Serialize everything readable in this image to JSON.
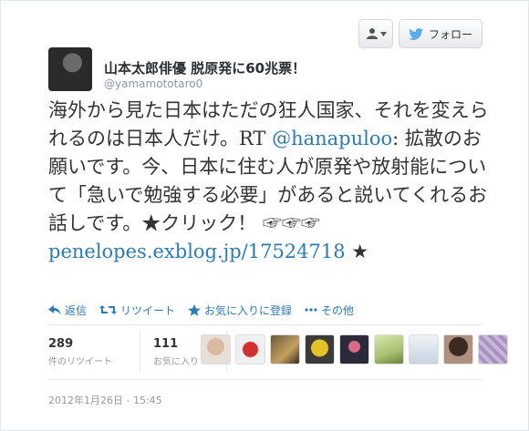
{
  "header": {
    "follow_label": "フォロー"
  },
  "author": {
    "name": "山本太郎俳優 脱原発に60兆票！",
    "handle": "@yamamototaro0"
  },
  "tweet": {
    "part1": "海外から見た日本はただの狂人国家、それを変えられるのは日本人だけ。RT ",
    "mention": "@hanapuloo",
    "part2": ": 拡散のお願いです。今、日本に住む人が原発や放射能について「急いで勉強する必要」があると説いてくれるお話しです。★クリック！ ☞☞☞ ",
    "link": "penelopes.exblog.jp/17524718",
    "part3": " ★"
  },
  "actions": {
    "reply": "返信",
    "retweet": "リツイート",
    "favorite": "お気に入りに登録",
    "more": "その他"
  },
  "stats": {
    "retweets_count": "289",
    "retweets_label": "件のリツイート",
    "favorites_count": "111",
    "favorites_label": "お気に入り"
  },
  "timestamp": "2012年1月26日 - 15:45"
}
